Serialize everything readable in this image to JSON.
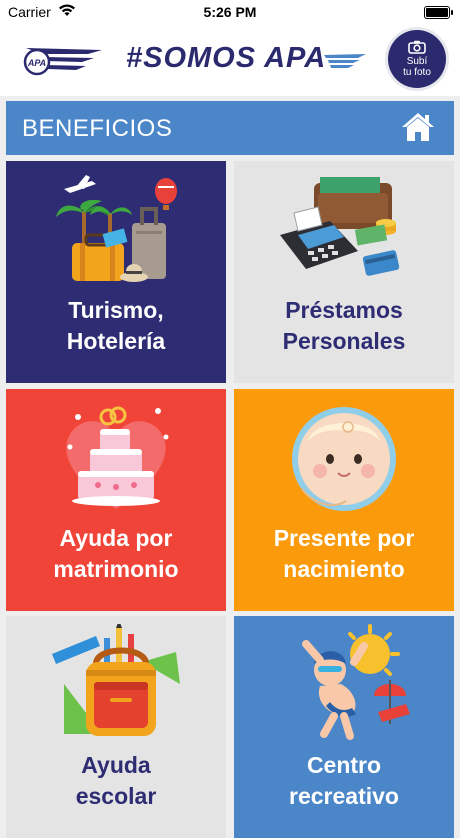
{
  "status_bar": {
    "carrier": "Carrier",
    "time": "5:26 PM"
  },
  "header": {
    "logo_text": "APA",
    "brand": "#SOMOS APA",
    "photo_button": {
      "line1": "Subí",
      "line2": "tu foto"
    }
  },
  "section": {
    "title": "BENEFICIOS"
  },
  "tiles": [
    {
      "line1": "Turismo,",
      "line2": "Hotelería",
      "icon": "travel-icon"
    },
    {
      "line1": "Préstamos",
      "line2": "Personales",
      "icon": "wallet-pos-icon"
    },
    {
      "line1": "Ayuda por",
      "line2": "matrimonio",
      "icon": "wedding-cake-icon"
    },
    {
      "line1": "Presente por",
      "line2": "nacimiento",
      "icon": "baby-icon"
    },
    {
      "line1": "Ayuda",
      "line2": "escolar",
      "icon": "school-backpack-icon"
    },
    {
      "line1": "Centro",
      "line2": "recreativo",
      "icon": "pool-swimmer-icon"
    }
  ],
  "colors": {
    "navy": "#2e2c73",
    "blue": "#4a86c8",
    "red": "#f04438",
    "orange": "#fb9b0b",
    "light_gray": "#e4e4e4"
  }
}
